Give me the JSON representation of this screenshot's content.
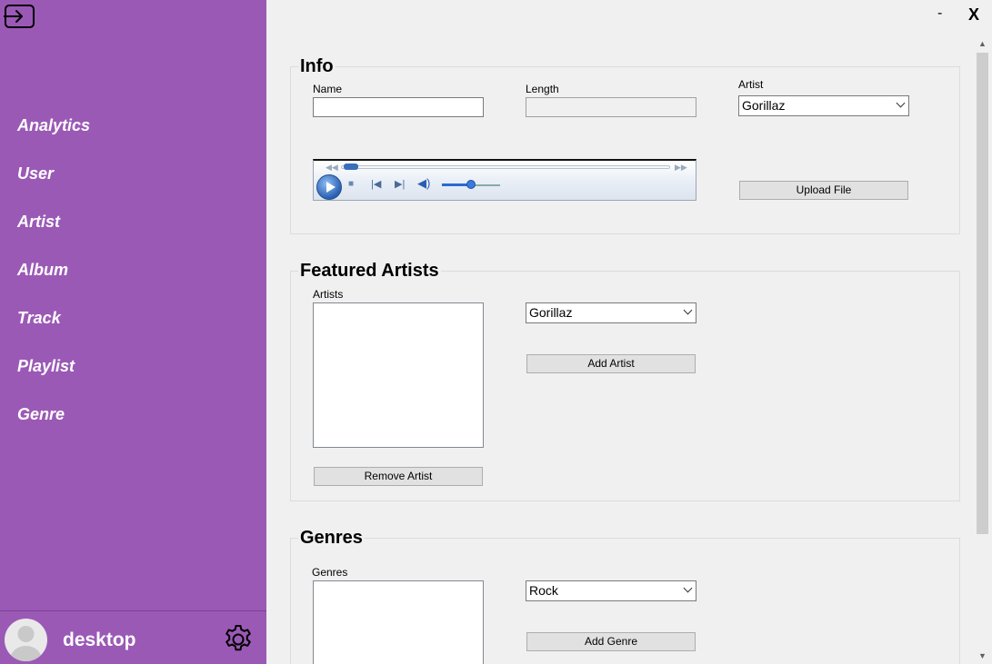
{
  "sidebar": {
    "logout_icon": "logout-icon",
    "nav": [
      {
        "label": "Analytics"
      },
      {
        "label": "User"
      },
      {
        "label": "Artist"
      },
      {
        "label": "Album"
      },
      {
        "label": "Track"
      },
      {
        "label": "Playlist"
      },
      {
        "label": "Genre"
      }
    ],
    "user": {
      "name": "desktop",
      "avatar_icon": "user-avatar-icon",
      "settings_icon": "gear-icon"
    },
    "color": "#9b59b6"
  },
  "window": {
    "minimize": "-",
    "close": "X"
  },
  "info": {
    "title": "Info",
    "name_label": "Name",
    "name_value": "",
    "length_label": "Length",
    "length_value": "",
    "artist_label": "Artist",
    "artist_selected": "Gorillaz",
    "upload_button": "Upload File",
    "player": {
      "progress": 0.03,
      "volume": 0.5
    }
  },
  "featured": {
    "title": "Featured Artists",
    "list_label": "Artists",
    "list_items": [],
    "artist_selected": "Gorillaz",
    "add_button": "Add Artist",
    "remove_button": "Remove Artist"
  },
  "genres": {
    "title": "Genres",
    "list_label": "Genres",
    "list_items": [],
    "genre_selected": "Rock",
    "add_button": "Add Genre"
  }
}
